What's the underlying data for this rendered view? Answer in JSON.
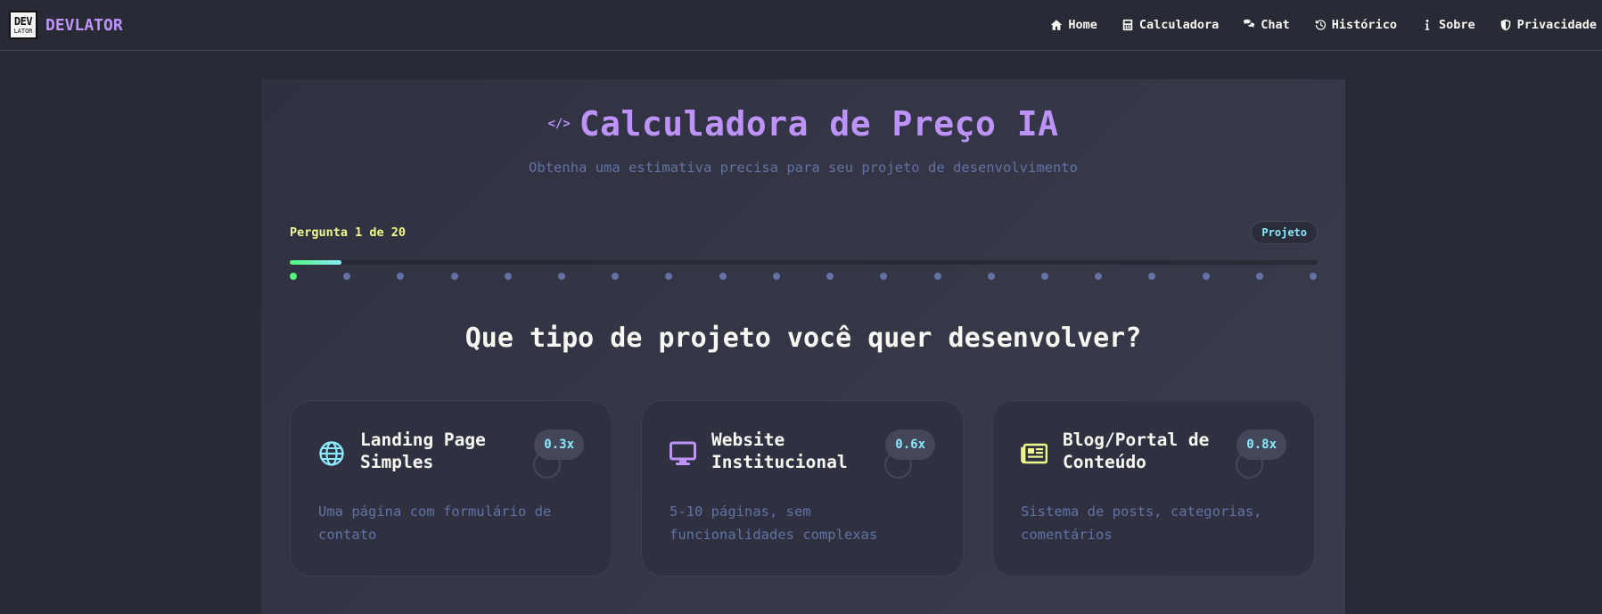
{
  "brand": {
    "logo_top": "DEV",
    "logo_bottom": "LATOR",
    "name": "DEVLATOR"
  },
  "nav": [
    {
      "label": "Home",
      "icon": "home-icon"
    },
    {
      "label": "Calculadora",
      "icon": "calculator-icon"
    },
    {
      "label": "Chat",
      "icon": "chat-icon"
    },
    {
      "label": "Histórico",
      "icon": "history-icon"
    },
    {
      "label": "Sobre",
      "icon": "info-icon"
    },
    {
      "label": "Privacidade",
      "icon": "shield-icon"
    }
  ],
  "header": {
    "icon_text": "</>",
    "title": "Calculadora de Preço IA",
    "subtitle": "Obtenha uma estimativa precisa para seu projeto de desenvolvimento"
  },
  "progress": {
    "counter": "Pergunta 1 de 20",
    "category": "Projeto",
    "current": 1,
    "total": 20,
    "fill_fraction": 0.05
  },
  "question": "Que tipo de projeto você quer desenvolver?",
  "options": [
    {
      "title": "Landing Page Simples",
      "multiplier": "0.3x",
      "description": "Uma página com formulário de contato",
      "icon": "globe-icon",
      "icon_color": "#8be9fd"
    },
    {
      "title": "Website Institucional",
      "multiplier": "0.6x",
      "description": "5-10 páginas, sem funcionalidades complexas",
      "icon": "monitor-icon",
      "icon_color": "#bd93f9"
    },
    {
      "title": "Blog/Portal de Conteúdo",
      "multiplier": "0.8x",
      "description": "Sistema de posts, categorias, comentários",
      "icon": "newspaper-icon",
      "icon_color": "#f1fa8c"
    }
  ],
  "colors": {
    "background": "#282a36",
    "accent_purple": "#bd93f9",
    "accent_cyan": "#8be9fd",
    "accent_green": "#50fa7b",
    "accent_yellow": "#f1fa8c",
    "muted": "#6272a4"
  }
}
